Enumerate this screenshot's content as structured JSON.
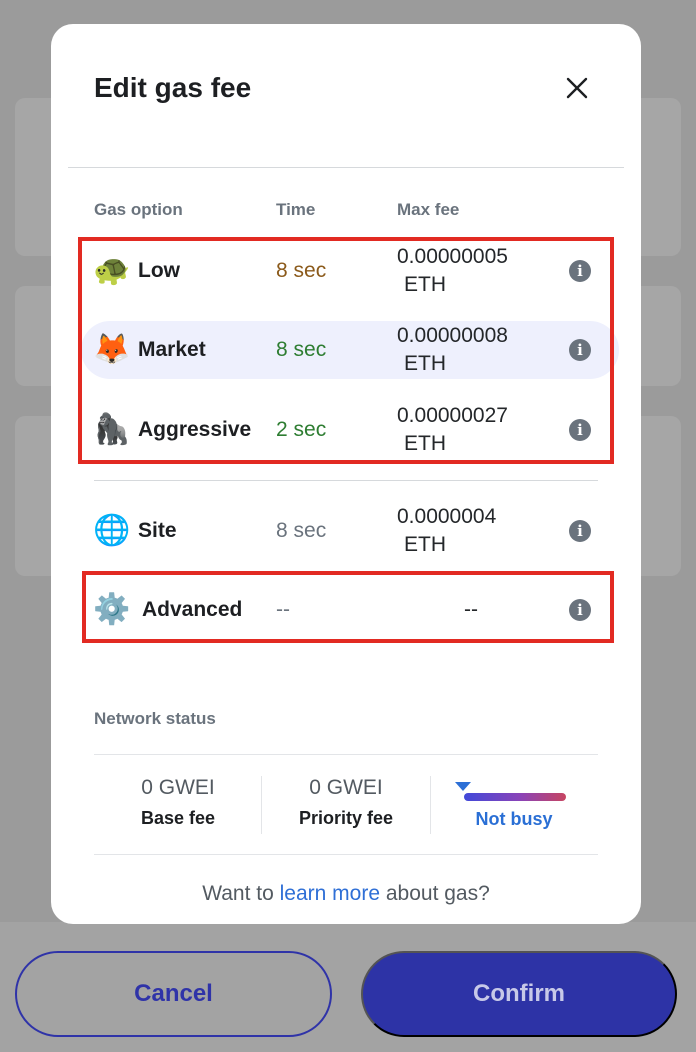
{
  "modal": {
    "title": "Edit gas fee",
    "columns": {
      "option": "Gas option",
      "time": "Time",
      "max_fee": "Max fee"
    },
    "options": [
      {
        "emoji": "🐢",
        "name": "Low",
        "time": "8 sec",
        "time_color": "#8b5a1b",
        "fee": "0.00000005",
        "unit": "ETH",
        "selected": false
      },
      {
        "emoji": "🦊",
        "name": "Market",
        "time": "8 sec",
        "time_color": "#2e7d32",
        "fee": "0.00000008",
        "unit": "ETH",
        "selected": true
      },
      {
        "emoji": "🦍",
        "name": "Aggressive",
        "time": "2 sec",
        "time_color": "#2e7d32",
        "fee": "0.00000027",
        "unit": "ETH",
        "selected": false
      },
      {
        "emoji": "🌐",
        "name": "Site",
        "time": "8 sec",
        "time_color": "#6a737d",
        "fee": "0.0000004",
        "unit": "ETH",
        "selected": false
      },
      {
        "emoji": "⚙️",
        "name": "Advanced",
        "time": "--",
        "time_color": "#6a737d",
        "fee": "--",
        "unit": "",
        "selected": false
      }
    ],
    "network": {
      "label": "Network status",
      "base_fee_value": "0 GWEI",
      "base_fee_label": "Base fee",
      "priority_fee_value": "0 GWEI",
      "priority_fee_label": "Priority fee",
      "status": "Not busy"
    },
    "learn": {
      "prefix": "Want to ",
      "link": "learn more",
      "suffix": " about gas?"
    }
  },
  "footer": {
    "cancel": "Cancel",
    "confirm": "Confirm"
  },
  "colors": {
    "accent": "#2f6fd6",
    "confirm_bg": "#2d33a6",
    "highlight_box": "#e22a22"
  }
}
